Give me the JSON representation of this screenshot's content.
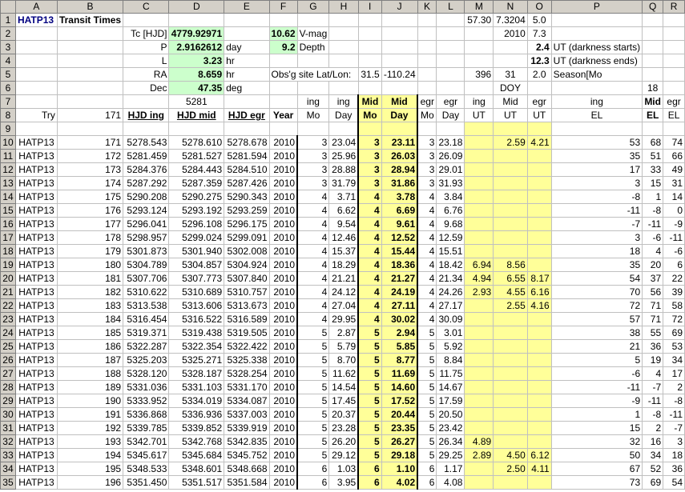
{
  "columns": [
    "A",
    "B",
    "C",
    "D",
    "E",
    "F",
    "G",
    "H",
    "I",
    "J",
    "K",
    "L",
    "M",
    "N",
    "O",
    "P",
    "Q",
    "R"
  ],
  "header": {
    "r1": {
      "a": "HATP13",
      "b": "Transit Times",
      "m": "57.30",
      "n": "7.3204",
      "o": "5.0"
    },
    "r2": {
      "c": "Tc [HJD]",
      "d": "4779.92971",
      "f": "10.62",
      "g": "V-mag",
      "n": "2010",
      "o": "7.3"
    },
    "r3": {
      "c": "P",
      "d": "2.9162612",
      "e": "day",
      "f": "9.2",
      "g": "Depth",
      "o": "2.4",
      "p": "UT (darkness starts)"
    },
    "r4": {
      "c": "L",
      "d": "3.23",
      "e": "hr",
      "o": "12.3",
      "p": "UT (darkness ends)"
    },
    "r5": {
      "c": "RA",
      "d": "8.659",
      "e": "hr",
      "f": "Obs'g site Lat/Lon:",
      "i": "31.5",
      "j": "-110.24",
      "m": "396",
      "n": "31",
      "o": "2.0",
      "p": "Season[Mo"
    },
    "r6": {
      "c": "Dec",
      "d": "47.35",
      "e": "deg",
      "n": "DOY",
      "q": "18"
    },
    "r7": {
      "d": "5281",
      "g": "ing",
      "h": "ing",
      "i": "Mid",
      "j": "Mid",
      "k": "egr",
      "l": "egr",
      "m": "ing",
      "n": "Mid",
      "o": "egr",
      "p": "ing",
      "q": "Mid",
      "r": "egr"
    },
    "r8": {
      "a": "Try",
      "b": "171",
      "c": "HJD ing",
      "d": "HJD mid",
      "e": "HJD egr",
      "f": "Year",
      "g": "Mo",
      "h": "Day",
      "i": "Mo",
      "j": "Day",
      "k": "Mo",
      "l": "Day",
      "m": "UT",
      "n": "UT",
      "o": "UT",
      "p": "EL",
      "q": "EL",
      "r": "EL"
    }
  },
  "rows": [
    [
      "HATP13",
      "171",
      "5278.543",
      "5278.610",
      "5278.678",
      "2010",
      "3",
      "23.04",
      "3",
      "23.11",
      "3",
      "23.18",
      "",
      "2.59",
      "4.21",
      "53",
      "68",
      "74"
    ],
    [
      "HATP13",
      "172",
      "5281.459",
      "5281.527",
      "5281.594",
      "2010",
      "3",
      "25.96",
      "3",
      "26.03",
      "3",
      "26.09",
      "",
      "",
      "",
      "35",
      "51",
      "66"
    ],
    [
      "HATP13",
      "173",
      "5284.376",
      "5284.443",
      "5284.510",
      "2010",
      "3",
      "28.88",
      "3",
      "28.94",
      "3",
      "29.01",
      "",
      "",
      "",
      "17",
      "33",
      "49"
    ],
    [
      "HATP13",
      "174",
      "5287.292",
      "5287.359",
      "5287.426",
      "2010",
      "3",
      "31.79",
      "3",
      "31.86",
      "3",
      "31.93",
      "",
      "",
      "",
      "3",
      "15",
      "31"
    ],
    [
      "HATP13",
      "175",
      "5290.208",
      "5290.275",
      "5290.343",
      "2010",
      "4",
      "3.71",
      "4",
      "3.78",
      "4",
      "3.84",
      "",
      "",
      "",
      "-8",
      "1",
      "14"
    ],
    [
      "HATP13",
      "176",
      "5293.124",
      "5293.192",
      "5293.259",
      "2010",
      "4",
      "6.62",
      "4",
      "6.69",
      "4",
      "6.76",
      "",
      "",
      "",
      "-11",
      "-8",
      "0"
    ],
    [
      "HATP13",
      "177",
      "5296.041",
      "5296.108",
      "5296.175",
      "2010",
      "4",
      "9.54",
      "4",
      "9.61",
      "4",
      "9.68",
      "",
      "",
      "",
      "-7",
      "-11",
      "-9"
    ],
    [
      "HATP13",
      "178",
      "5298.957",
      "5299.024",
      "5299.091",
      "2010",
      "4",
      "12.46",
      "4",
      "12.52",
      "4",
      "12.59",
      "",
      "",
      "",
      "3",
      "-6",
      "-11"
    ],
    [
      "HATP13",
      "179",
      "5301.873",
      "5301.940",
      "5302.008",
      "2010",
      "4",
      "15.37",
      "4",
      "15.44",
      "4",
      "15.51",
      "",
      "",
      "",
      "18",
      "4",
      "-6"
    ],
    [
      "HATP13",
      "180",
      "5304.789",
      "5304.857",
      "5304.924",
      "2010",
      "4",
      "18.29",
      "4",
      "18.36",
      "4",
      "18.42",
      "6.94",
      "8.56",
      "",
      "35",
      "20",
      "6"
    ],
    [
      "HATP13",
      "181",
      "5307.706",
      "5307.773",
      "5307.840",
      "2010",
      "4",
      "21.21",
      "4",
      "21.27",
      "4",
      "21.34",
      "4.94",
      "6.55",
      "8.17",
      "54",
      "37",
      "22"
    ],
    [
      "HATP13",
      "182",
      "5310.622",
      "5310.689",
      "5310.757",
      "2010",
      "4",
      "24.12",
      "4",
      "24.19",
      "4",
      "24.26",
      "2.93",
      "4.55",
      "6.16",
      "70",
      "56",
      "39"
    ],
    [
      "HATP13",
      "183",
      "5313.538",
      "5313.606",
      "5313.673",
      "2010",
      "4",
      "27.04",
      "4",
      "27.11",
      "4",
      "27.17",
      "",
      "2.55",
      "4.16",
      "72",
      "71",
      "58"
    ],
    [
      "HATP13",
      "184",
      "5316.454",
      "5316.522",
      "5316.589",
      "2010",
      "4",
      "29.95",
      "4",
      "30.02",
      "4",
      "30.09",
      "",
      "",
      "",
      "57",
      "71",
      "72"
    ],
    [
      "HATP13",
      "185",
      "5319.371",
      "5319.438",
      "5319.505",
      "2010",
      "5",
      "2.87",
      "5",
      "2.94",
      "5",
      "3.01",
      "",
      "",
      "",
      "38",
      "55",
      "69"
    ],
    [
      "HATP13",
      "186",
      "5322.287",
      "5322.354",
      "5322.422",
      "2010",
      "5",
      "5.79",
      "5",
      "5.85",
      "5",
      "5.92",
      "",
      "",
      "",
      "21",
      "36",
      "53"
    ],
    [
      "HATP13",
      "187",
      "5325.203",
      "5325.271",
      "5325.338",
      "2010",
      "5",
      "8.70",
      "5",
      "8.77",
      "5",
      "8.84",
      "",
      "",
      "",
      "5",
      "19",
      "34"
    ],
    [
      "HATP13",
      "188",
      "5328.120",
      "5328.187",
      "5328.254",
      "2010",
      "5",
      "11.62",
      "5",
      "11.69",
      "5",
      "11.75",
      "",
      "",
      "",
      "-6",
      "4",
      "17"
    ],
    [
      "HATP13",
      "189",
      "5331.036",
      "5331.103",
      "5331.170",
      "2010",
      "5",
      "14.54",
      "5",
      "14.60",
      "5",
      "14.67",
      "",
      "",
      "",
      "-11",
      "-7",
      "2"
    ],
    [
      "HATP13",
      "190",
      "5333.952",
      "5334.019",
      "5334.087",
      "2010",
      "5",
      "17.45",
      "5",
      "17.52",
      "5",
      "17.59",
      "",
      "",
      "",
      "-9",
      "-11",
      "-8"
    ],
    [
      "HATP13",
      "191",
      "5336.868",
      "5336.936",
      "5337.003",
      "2010",
      "5",
      "20.37",
      "5",
      "20.44",
      "5",
      "20.50",
      "",
      "",
      "",
      "1",
      "-8",
      "-11"
    ],
    [
      "HATP13",
      "192",
      "5339.785",
      "5339.852",
      "5339.919",
      "2010",
      "5",
      "23.28",
      "5",
      "23.35",
      "5",
      "23.42",
      "",
      "",
      "",
      "15",
      "2",
      "-7"
    ],
    [
      "HATP13",
      "193",
      "5342.701",
      "5342.768",
      "5342.835",
      "2010",
      "5",
      "26.20",
      "5",
      "26.27",
      "5",
      "26.34",
      "4.89",
      "",
      "",
      "32",
      "16",
      "3"
    ],
    [
      "HATP13",
      "194",
      "5345.617",
      "5345.684",
      "5345.752",
      "2010",
      "5",
      "29.12",
      "5",
      "29.18",
      "5",
      "29.25",
      "2.89",
      "4.50",
      "6.12",
      "50",
      "34",
      "18"
    ],
    [
      "HATP13",
      "195",
      "5348.533",
      "5348.601",
      "5348.668",
      "2010",
      "6",
      "1.03",
      "6",
      "1.10",
      "6",
      "1.17",
      "",
      "2.50",
      "4.11",
      "67",
      "52",
      "36"
    ],
    [
      "HATP13",
      "196",
      "5351.450",
      "5351.517",
      "5351.584",
      "2010",
      "6",
      "3.95",
      "6",
      "4.02",
      "6",
      "4.08",
      "",
      "",
      "",
      "73",
      "69",
      "54"
    ]
  ]
}
